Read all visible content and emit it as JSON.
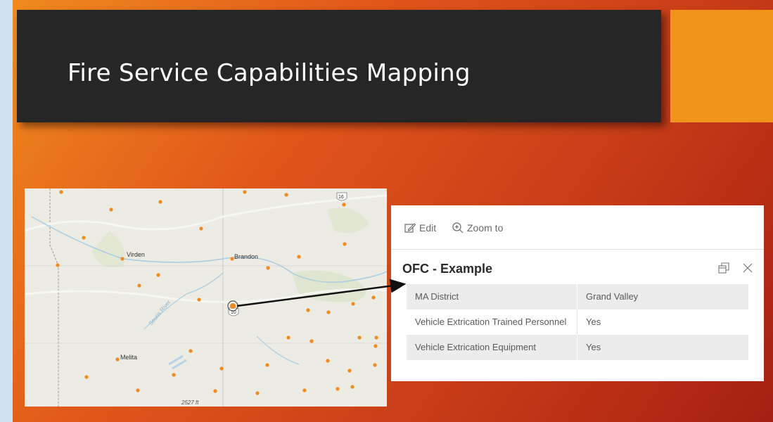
{
  "slide": {
    "title": "Fire Service Capabilities Mapping",
    "colors": {
      "title_bar": "#262626",
      "accent": "#f0941c",
      "background_start": "#f08a1e",
      "background_end": "#a51f12"
    }
  },
  "map": {
    "cities": [
      "Virden",
      "Brandon",
      "Melita"
    ],
    "scale": "2527 ft",
    "highway_shields": [
      "16",
      "10"
    ],
    "marker_color": "#f28a1c"
  },
  "popup": {
    "toolbar": {
      "edit_label": "Edit",
      "zoom_label": "Zoom to"
    },
    "title": "OFC - Example",
    "rows": [
      {
        "field": "MA District",
        "value": "Grand Valley"
      },
      {
        "field": "Vehicle Extrication Trained Personnel",
        "value": "Yes"
      },
      {
        "field": "Vehicle Extrication Equipment",
        "value": "Yes"
      }
    ]
  }
}
